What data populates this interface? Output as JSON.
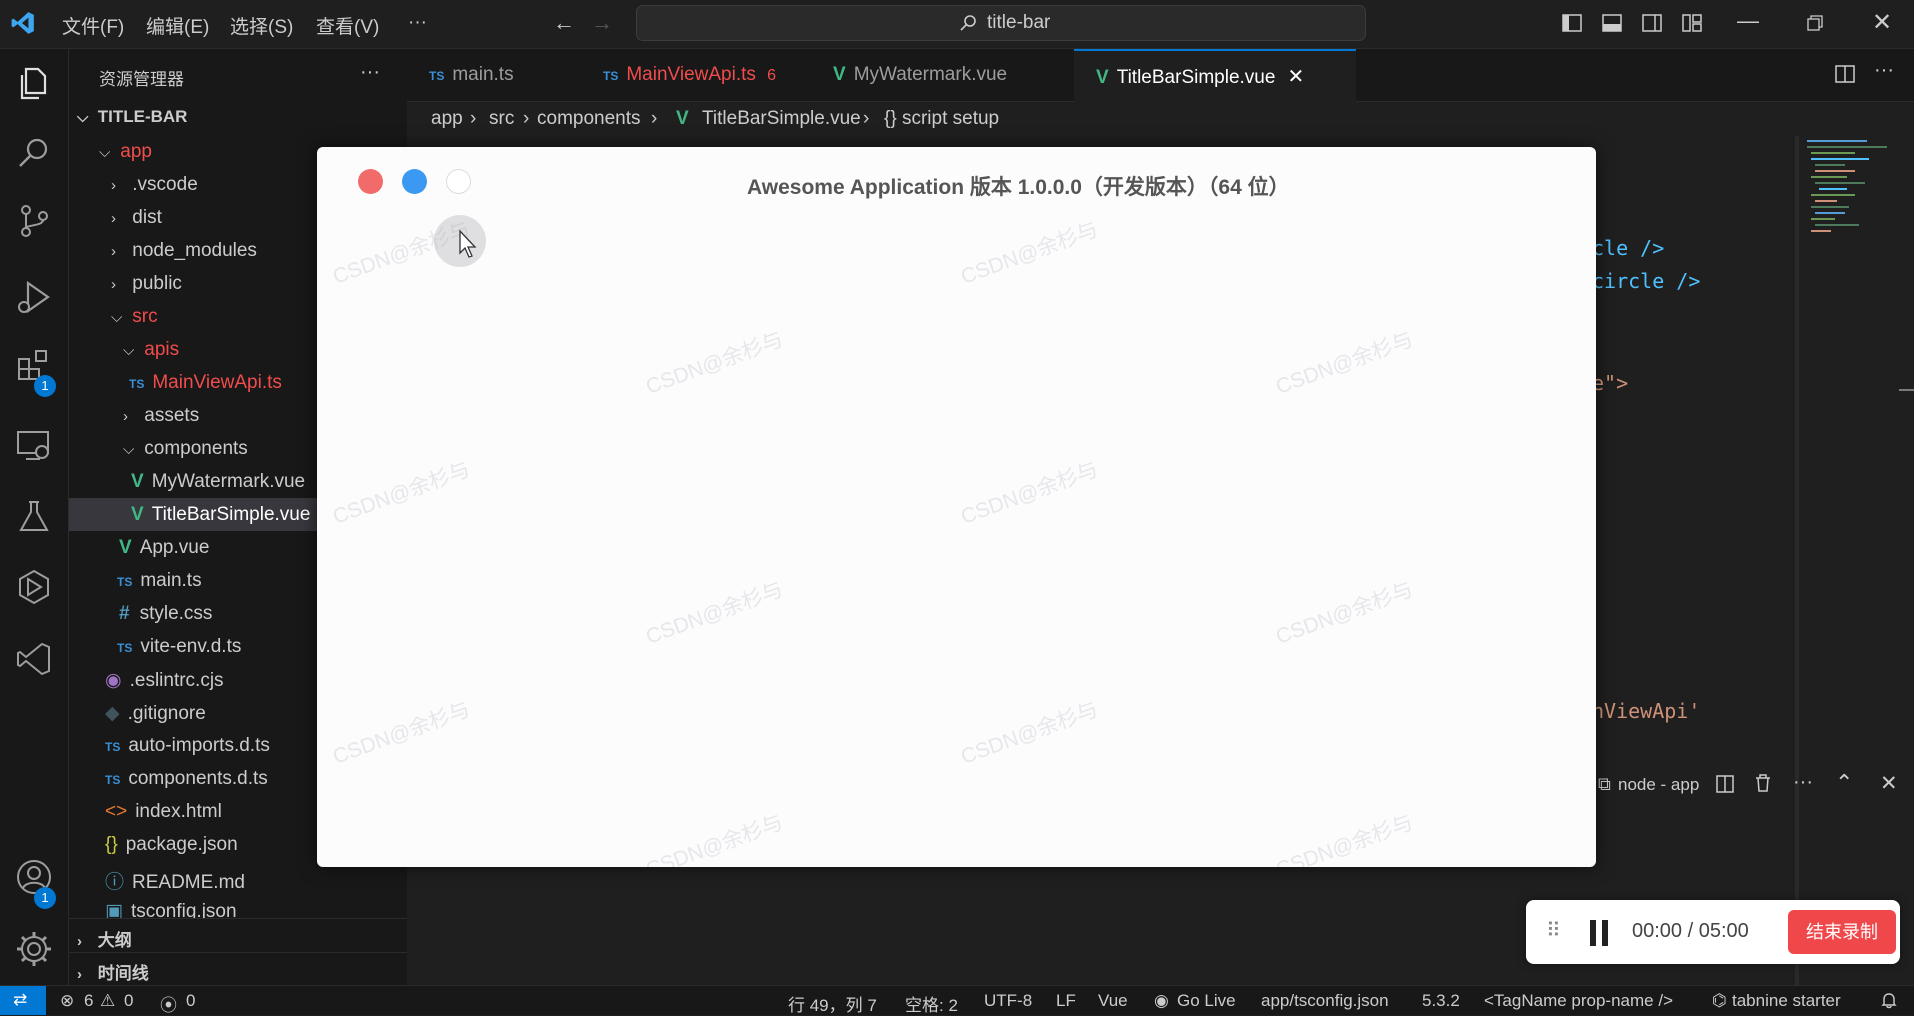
{
  "titlebar": {
    "menus": [
      "文件(F)",
      "编辑(E)",
      "选择(S)",
      "查看(V)",
      "···"
    ],
    "search": "title-bar"
  },
  "sidebar": {
    "header": "资源管理器",
    "more": "···",
    "project": "TITLE-BAR",
    "items": [
      {
        "label": "app"
      },
      {
        "label": ".vscode"
      },
      {
        "label": "dist"
      },
      {
        "label": "node_modules"
      },
      {
        "label": "public"
      },
      {
        "label": "src"
      },
      {
        "label": "apis"
      },
      {
        "label": "MainViewApi.ts"
      },
      {
        "label": "assets"
      },
      {
        "label": "components"
      },
      {
        "label": "MyWatermark.vue"
      },
      {
        "label": "TitleBarSimple.vue"
      },
      {
        "label": "App.vue"
      },
      {
        "label": "main.ts"
      },
      {
        "label": "style.css"
      },
      {
        "label": "vite-env.d.ts"
      },
      {
        "label": ".eslintrc.cjs"
      },
      {
        "label": ".gitignore"
      },
      {
        "label": "auto-imports.d.ts"
      },
      {
        "label": "components.d.ts"
      },
      {
        "label": "index.html"
      },
      {
        "label": "package.json"
      },
      {
        "label": "README.md"
      },
      {
        "label": "tsconfig.json"
      }
    ],
    "outline": "大纲",
    "timeline": "时间线"
  },
  "activity": {
    "extensions_badge": "1",
    "accounts_badge": "1"
  },
  "tabs": [
    {
      "label": "main.ts"
    },
    {
      "label": "MainViewApi.ts",
      "problems": "6"
    },
    {
      "label": "MyWatermark.vue"
    },
    {
      "label": "TitleBarSimple.vue"
    }
  ],
  "breadcrumb": [
    "app",
    "src",
    "components",
    "TitleBarSimple.vue",
    "{} script setup"
  ],
  "code_fragments": [
    "cle />",
    "circle />",
    "e\">",
    "nViewApi'"
  ],
  "dialog": {
    "title": "Awesome Application 版本 1.0.0.0（开发版本）（64 位）",
    "watermark": "CSDN@余杉与"
  },
  "panel": {
    "terminal": "node - app"
  },
  "recorder": {
    "time": "00:00 / 05:00",
    "stop": "结束录制"
  },
  "statusbar": {
    "errors": "6",
    "warnings": "0",
    "ports": "0",
    "position": "行 49，列 7",
    "spaces": "空格: 2",
    "encoding": "UTF-8",
    "eol": "LF",
    "language": "Vue",
    "golive": "Go Live",
    "tsconfig": "app/tsconfig.json",
    "version": "5.3.2",
    "tagname": "<TagName prop-name />",
    "tabnine": "tabnine starter"
  },
  "colors": {
    "accent": "#0078d4",
    "error": "#f14c4c",
    "vue": "#41b883",
    "close_btn": "#f16b6b",
    "min_btn": "#3b99f2",
    "stop_btn": "#f0474b"
  }
}
